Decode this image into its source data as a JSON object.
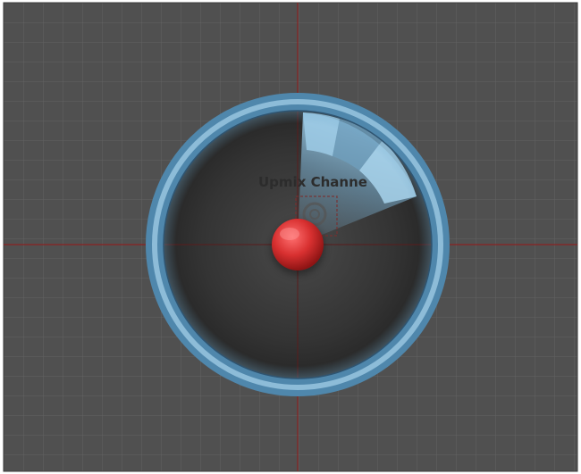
{
  "panel": {
    "label": "Upmix Channe"
  },
  "colors": {
    "grid_background": "#505050",
    "grid_line": "#626262",
    "crosshair": "#8a2222",
    "ring": "#6aa2c4",
    "sector": "#7fb6d8",
    "emitter": "#d83030"
  },
  "icons": {
    "ring": "speaker-ring",
    "emitter": "emitter-ball",
    "center": "listener-icon"
  }
}
